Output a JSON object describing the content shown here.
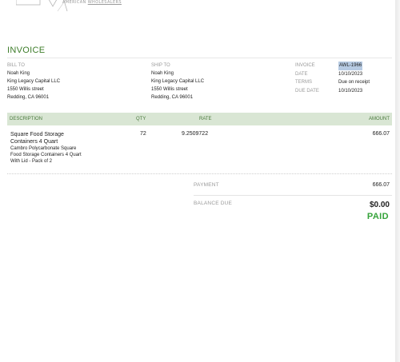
{
  "logo": {
    "text_left": "AMERICAN",
    "text_right": "WHOLESALERS"
  },
  "title": "INVOICE",
  "bill_to": {
    "label": "BILL TO",
    "lines": [
      "Noah King",
      "King Legacy Capital LLC",
      "1550 Willis street",
      "Redding, CA  96001"
    ]
  },
  "ship_to": {
    "label": "SHIP TO",
    "lines": [
      "Noah King",
      "King Legacy Capital LLC",
      "1550 Willis street",
      "Redding, CA  96001"
    ]
  },
  "meta": [
    {
      "key": "INVOICE",
      "value": "AWL-1966"
    },
    {
      "key": "DATE",
      "value": "10/10/2023"
    },
    {
      "key": "TERMS",
      "value": "Due on receipt"
    },
    {
      "key": "DUE DATE",
      "value": "10/10/2023"
    }
  ],
  "table": {
    "headers": {
      "description": "DESCRIPTION",
      "qty": "QTY",
      "rate": "RATE",
      "amount": "AMOUNT"
    },
    "rows": [
      {
        "name": "Square Food Storage Containers 4 Quart",
        "description": "Cambro Polycarbonate Square Food Storage Containers 4 Quart With Lid - Pack of 2",
        "qty": "72",
        "rate": "9.2509722",
        "amount": "666.07"
      }
    ]
  },
  "totals": {
    "payment_label": "PAYMENT",
    "payment_value": "666.07",
    "balance_label": "BALANCE DUE",
    "balance_value": "$0.00",
    "status": "PAID"
  },
  "colors": {
    "accent": "#3e7d2a",
    "header_bg": "#d9e6d4",
    "paid": "#35a33a",
    "highlight": "#b7cbe3"
  }
}
